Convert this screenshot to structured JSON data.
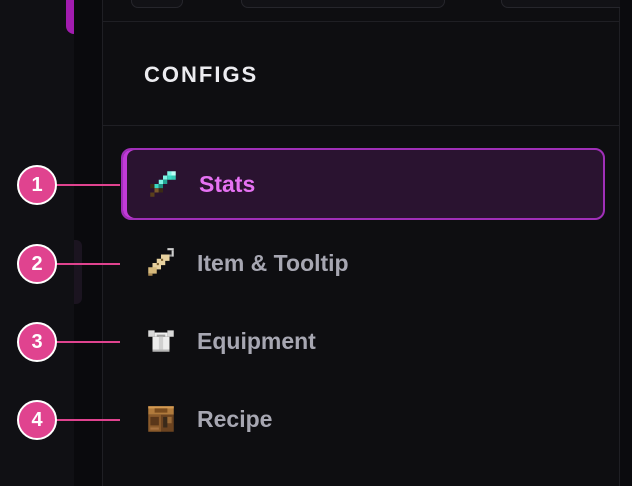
{
  "panel": {
    "title": "CONFIGS"
  },
  "nav": {
    "items": [
      {
        "label": "Stats",
        "icon": "diamond-sword-icon",
        "active": true
      },
      {
        "label": "Item & Tooltip",
        "icon": "name-tag-icon",
        "active": false
      },
      {
        "label": "Equipment",
        "icon": "chestplate-icon",
        "active": false
      },
      {
        "label": "Recipe",
        "icon": "crafting-table-icon",
        "active": false
      }
    ]
  },
  "callouts": [
    "1",
    "2",
    "3",
    "4"
  ],
  "colors": {
    "accent": "#e672f3",
    "active_border": "#a02fb8",
    "callout": "#e0438f"
  }
}
